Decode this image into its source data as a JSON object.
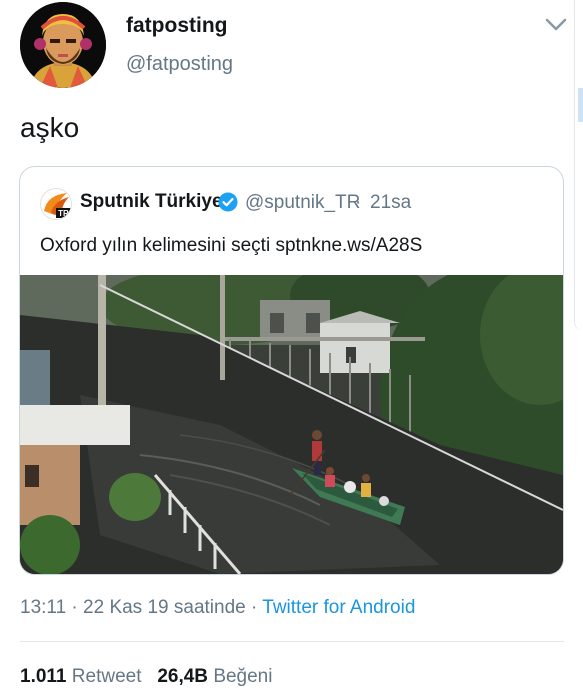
{
  "author": {
    "display_name": "fatposting",
    "handle": "@fatposting",
    "avatar_icon": "avatar-illustration-icon"
  },
  "tweet": {
    "text": "aşko",
    "time": "13:11",
    "separator": "·",
    "date": "22 Kas 19 saatinde",
    "source": "Twitter for Android"
  },
  "quoted": {
    "display_name": "Sputnik Türkiye",
    "handle": "@sputnik_TR",
    "separator": "·",
    "age": "21sa",
    "text": "Oxford yılın kelimesini seçti sptnkne.ws/A28S",
    "avatar_badge": "TR",
    "media": "flooded-street-boat-photo"
  },
  "stats": {
    "retweet_count": "1.011",
    "retweet_label": "Retweet",
    "like_count": "26,4B",
    "like_label": "Beğeni"
  },
  "colors": {
    "text": "#14171a",
    "secondary": "#657786",
    "link": "#1b95e0",
    "border": "#ccd6dd",
    "verified": "#1da1f2"
  }
}
